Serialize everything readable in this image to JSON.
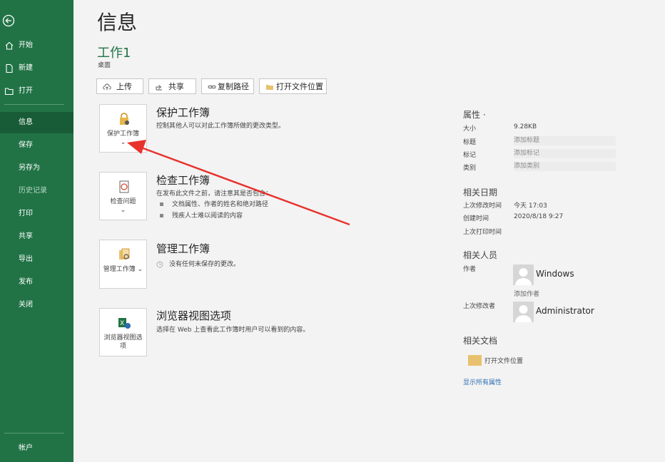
{
  "sidebar": {
    "items": [
      {
        "label": "开始",
        "icon": "home-icon"
      },
      {
        "label": "新建",
        "icon": "new-document-icon"
      },
      {
        "label": "打开",
        "icon": "open-folder-icon"
      },
      {
        "label": "信息"
      },
      {
        "label": "保存"
      },
      {
        "label": "另存为"
      },
      {
        "label": "历史记录"
      },
      {
        "label": "打印"
      },
      {
        "label": "共享"
      },
      {
        "label": "导出"
      },
      {
        "label": "发布"
      },
      {
        "label": "关闭"
      }
    ],
    "account_label": "帐户"
  },
  "page": {
    "title": "信息",
    "doc_name": "工作1",
    "doc_path": "桌面"
  },
  "toolbar": {
    "upload": "上传",
    "share": "共享",
    "copy_path": "复制路径",
    "open_location": "打开文件位置"
  },
  "sections": {
    "protect": {
      "button": "保护工作簿",
      "title": "保护工作簿",
      "desc": "控制其他人可以对此工作簿所做的更改类型。"
    },
    "inspect": {
      "button": "检查问题",
      "title": "检查工作簿",
      "desc": "在发布此文件之前，请注意其是否包含：",
      "bullets": [
        "文档属性、作者的姓名和绝对路径",
        "残疾人士难以阅读的内容"
      ]
    },
    "manage": {
      "button": "管理工作簿",
      "title": "管理工作簿",
      "desc": "没有任何未保存的更改。"
    },
    "browser": {
      "button": "浏览器视图选项",
      "title": "浏览器视图选项",
      "desc": "选择在 Web 上查看此工作簿时用户可以看到的内容。"
    }
  },
  "properties": {
    "heading": "属性 ·",
    "size_label": "大小",
    "size_value": "9.28KB",
    "title_label": "标题",
    "title_value": "添加标题",
    "tags_label": "标记",
    "tags_value": "添加标记",
    "category_label": "类别",
    "category_value": "添加类别"
  },
  "dates": {
    "heading": "相关日期",
    "modified_label": "上次修改时间",
    "modified_value": "今天 17:03",
    "created_label": "创建时间",
    "created_value": "2020/8/18 9:27",
    "printed_label": "上次打印时间"
  },
  "people": {
    "heading": "相关人员",
    "author_label": "作者",
    "author_name": "Windows",
    "add_author": "添加作者",
    "modifier_label": "上次修改者",
    "modifier_name": "Administrator"
  },
  "documents": {
    "heading": "相关文档",
    "open_location": "打开文件位置",
    "show_all": "显示所有属性"
  },
  "colors": {
    "accent": "#217346",
    "selected": "#185c37",
    "annotation": "#e8322c"
  }
}
